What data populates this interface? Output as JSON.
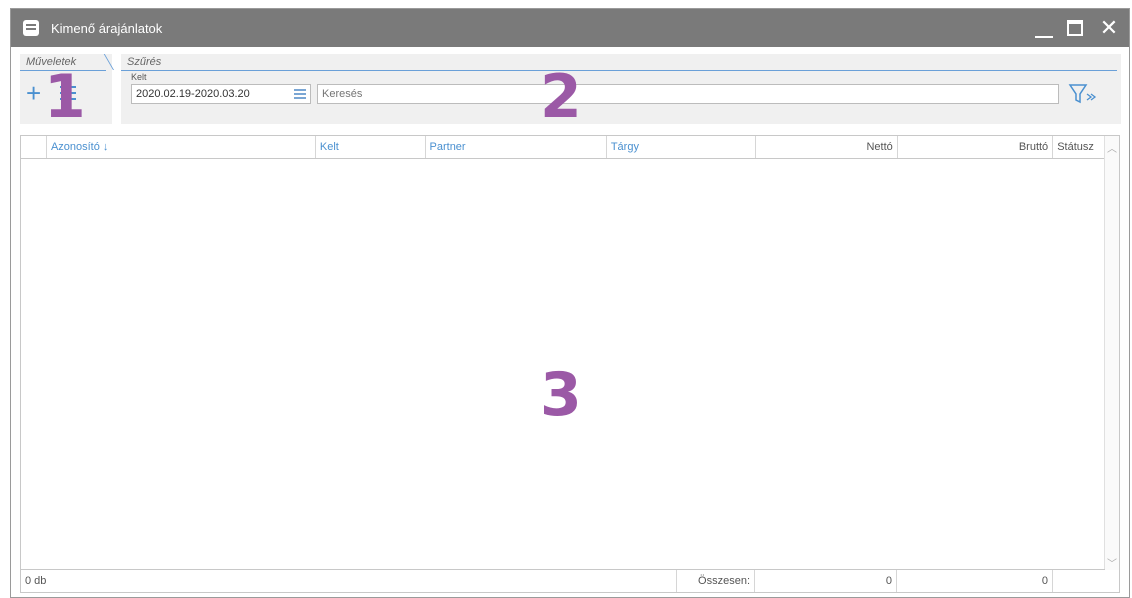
{
  "window": {
    "title": "Kimenő árajánlatok"
  },
  "panels": {
    "operations_tab": "Műveletek",
    "filter_tab": "Szűrés",
    "kelt_label": "Kelt",
    "date_range": "2020.02.19-2020.03.20",
    "search_placeholder": "Keresés"
  },
  "markers": {
    "m1": "1",
    "m2": "2",
    "m3": "3"
  },
  "table": {
    "columns": [
      "Azonosító ↓",
      "Kelt",
      "Partner",
      "Tárgy",
      "Nettó",
      "Bruttó",
      "Státusz"
    ]
  },
  "footer": {
    "count": "0 db",
    "total_label": "Összesen:",
    "netto_total": "0",
    "brutto_total": "0"
  },
  "colors": {
    "accent": "#4a90d0",
    "titlebar": "#7a7a7a",
    "marker": "#9b59a6"
  }
}
